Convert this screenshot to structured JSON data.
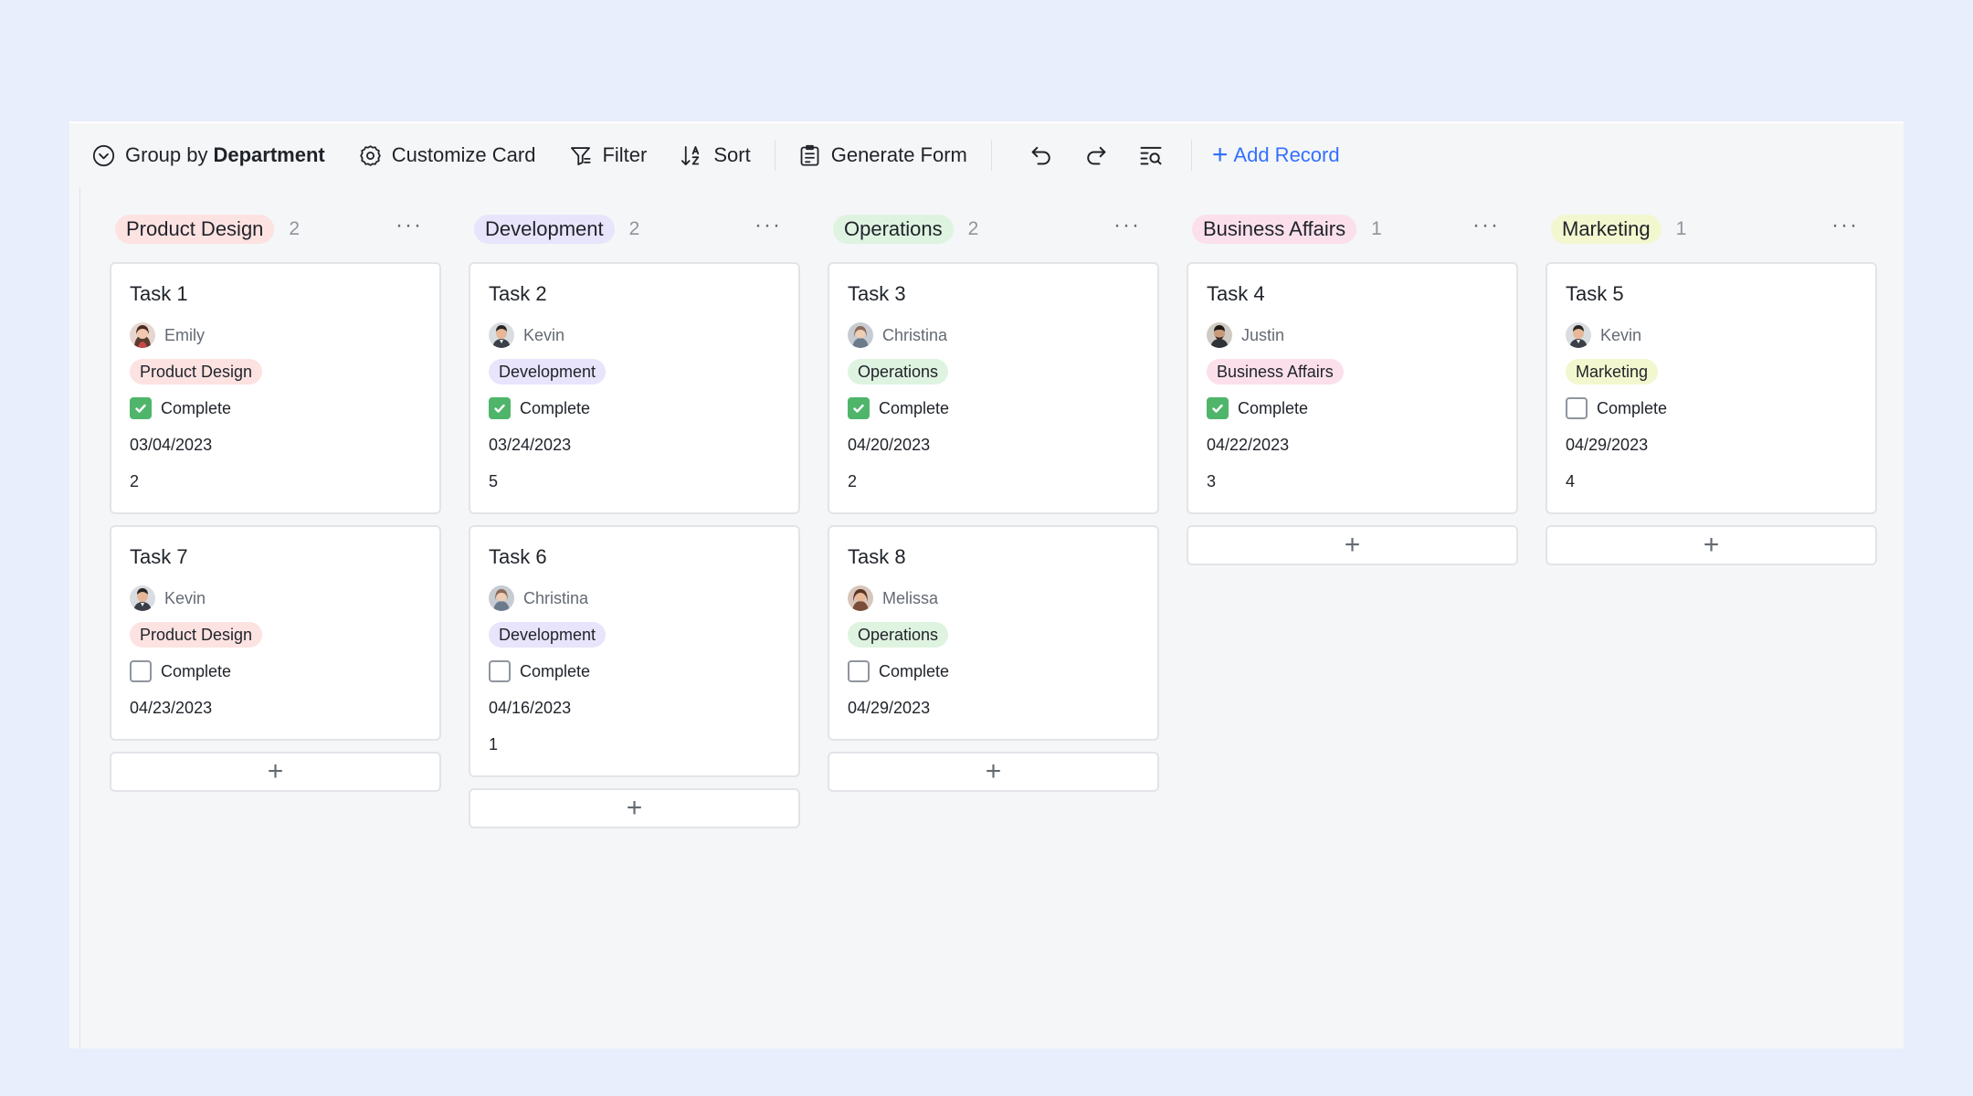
{
  "toolbar": {
    "group_prefix": "Group by",
    "group_field": "Department",
    "customize": "Customize Card",
    "filter": "Filter",
    "sort": "Sort",
    "generate_form": "Generate Form",
    "add_record": "Add Record"
  },
  "colors": {
    "accent": "#3370ff",
    "check_green": "#4fb56b",
    "product_design": "#fde2e2",
    "development": "#e8e4fb",
    "operations": "#dff3e1",
    "business_affairs": "#fbe0ec",
    "marketing": "#f3f7cf"
  },
  "status_label": "Complete",
  "columns": [
    {
      "name": "Product Design",
      "count": "2",
      "color": "#fde2e2",
      "cards": [
        {
          "title": "Task 1",
          "person": "Emily",
          "avatar": "emily",
          "dept": "Product Design",
          "complete": true,
          "date": "03/04/2023",
          "number": "2"
        },
        {
          "title": "Task 7",
          "person": "Kevin",
          "avatar": "kevin",
          "dept": "Product Design",
          "complete": false,
          "date": "04/23/2023",
          "number": ""
        }
      ]
    },
    {
      "name": "Development",
      "count": "2",
      "color": "#e8e4fb",
      "cards": [
        {
          "title": "Task 2",
          "person": "Kevin",
          "avatar": "kevin",
          "dept": "Development",
          "complete": true,
          "date": "03/24/2023",
          "number": "5"
        },
        {
          "title": "Task 6",
          "person": "Christina",
          "avatar": "christina",
          "dept": "Development",
          "complete": false,
          "date": "04/16/2023",
          "number": "1"
        }
      ]
    },
    {
      "name": "Operations",
      "count": "2",
      "color": "#dff3e1",
      "cards": [
        {
          "title": "Task 3",
          "person": "Christina",
          "avatar": "christina",
          "dept": "Operations",
          "complete": true,
          "date": "04/20/2023",
          "number": "2"
        },
        {
          "title": "Task 8",
          "person": "Melissa",
          "avatar": "melissa",
          "dept": "Operations",
          "complete": false,
          "date": "04/29/2023",
          "number": ""
        }
      ]
    },
    {
      "name": "Business Affairs",
      "count": "1",
      "color": "#fbe0ec",
      "cards": [
        {
          "title": "Task 4",
          "person": "Justin",
          "avatar": "justin",
          "dept": "Business Affairs",
          "complete": true,
          "date": "04/22/2023",
          "number": "3"
        }
      ]
    },
    {
      "name": "Marketing",
      "count": "1",
      "color": "#f3f7cf",
      "cards": [
        {
          "title": "Task 5",
          "person": "Kevin",
          "avatar": "kevin",
          "dept": "Marketing",
          "complete": false,
          "date": "04/29/2023",
          "number": "4"
        }
      ]
    }
  ]
}
